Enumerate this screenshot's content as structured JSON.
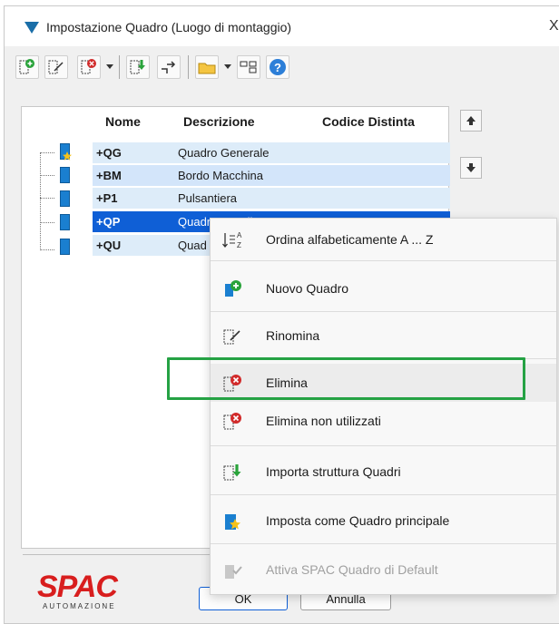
{
  "window": {
    "title": "Impostazione Quadro (Luogo di montaggio)",
    "close_glyph": "X"
  },
  "toolbar": {
    "buttons": [
      "new-quadro-icon",
      "rename-icon",
      "delete-icon",
      "import-icon",
      "move-icon",
      "folder-icon",
      "structure-icon",
      "help-icon"
    ]
  },
  "table": {
    "headers": {
      "name": "Nome",
      "description": "Descrizione",
      "code": "Codice Distinta"
    },
    "rows": [
      {
        "name": "+QG",
        "description": "Quadro Generale",
        "code": ""
      },
      {
        "name": "+BM",
        "description": "Bordo Macchina",
        "code": ""
      },
      {
        "name": "+P1",
        "description": "Pulsantiera",
        "code": ""
      },
      {
        "name": "+QP",
        "description": "Quadro Pensile",
        "code": ""
      },
      {
        "name": "+QU",
        "description": "Quad",
        "code": ""
      }
    ]
  },
  "footer": {
    "logo_main": "SPAC",
    "logo_sub": "AUTOMAZIONE",
    "ok_label": "OK",
    "cancel_label": "Annulla"
  },
  "context_menu": {
    "items": [
      {
        "label": "Ordina alfabeticamente A ... Z",
        "icon": "sort-az-icon",
        "enabled": true
      },
      {
        "label": "Nuovo Quadro",
        "icon": "new-quadro-icon",
        "enabled": true
      },
      {
        "label": "Rinomina",
        "icon": "rename-icon",
        "enabled": true
      },
      {
        "label": "Elimina",
        "icon": "delete-icon",
        "enabled": true
      },
      {
        "label": "Elimina non utilizzati",
        "icon": "delete-unused-icon",
        "enabled": true
      },
      {
        "label": "Importa struttura Quadri",
        "icon": "import-structure-icon",
        "enabled": true
      },
      {
        "label": "Imposta come Quadro principale",
        "icon": "set-main-icon",
        "enabled": true
      },
      {
        "label": "Attiva SPAC Quadro di Default",
        "icon": "activate-default-icon",
        "enabled": false
      }
    ]
  },
  "colors": {
    "accent": "#0f5fd6",
    "highlight": "#25a244",
    "brand": "#d81e1e"
  }
}
